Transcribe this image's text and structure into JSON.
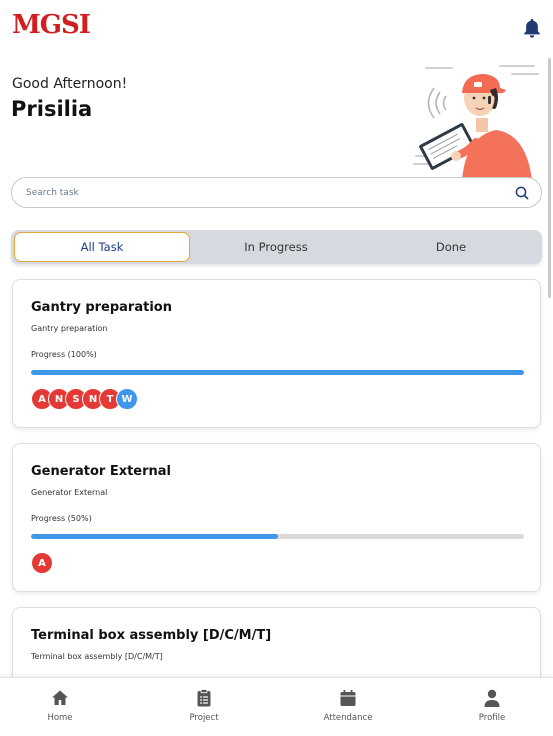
{
  "header": {
    "logo_text": "MGSI",
    "notification_icon": "bell-icon"
  },
  "greeting": {
    "salutation": "Good Afternoon!",
    "name": "Prisilia"
  },
  "search": {
    "placeholder": "Search task",
    "icon": "search-icon"
  },
  "tabs": [
    {
      "label": "All Task",
      "active": true
    },
    {
      "label": "In Progress",
      "active": false
    },
    {
      "label": "Done",
      "active": false
    }
  ],
  "tasks": [
    {
      "title": "Gantry preparation",
      "subtitle": "Gantry preparation",
      "progress_label": "Progress (100%)",
      "progress": 1.0,
      "assignees": [
        {
          "initial": "A",
          "color": "#e53935"
        },
        {
          "initial": "N",
          "color": "#e53935"
        },
        {
          "initial": "S",
          "color": "#e53935"
        },
        {
          "initial": "N",
          "color": "#e53935"
        },
        {
          "initial": "T",
          "color": "#e53935"
        },
        {
          "initial": "W",
          "color": "#3e97e8"
        }
      ]
    },
    {
      "title": "Generator External",
      "subtitle": "Generator External",
      "progress_label": "Progress (50%)",
      "progress": 0.5,
      "assignees": [
        {
          "initial": "A",
          "color": "#e53935"
        }
      ]
    },
    {
      "title": "Terminal box assembly [D/C/M/T]",
      "subtitle": "Terminal box assembly [D/C/M/T]"
    }
  ],
  "bottom_nav": [
    {
      "label": "Home",
      "icon": "home-icon"
    },
    {
      "label": "Project",
      "icon": "clipboard-icon"
    },
    {
      "label": "Attendance",
      "icon": "calendar-icon"
    },
    {
      "label": "Profile",
      "icon": "person-icon"
    }
  ],
  "colors": {
    "brand_red": "#d11f1f",
    "progress_blue": "#3e97e8",
    "active_tab_border": "#e4a73b",
    "bell_navy": "#1e3a6e"
  }
}
